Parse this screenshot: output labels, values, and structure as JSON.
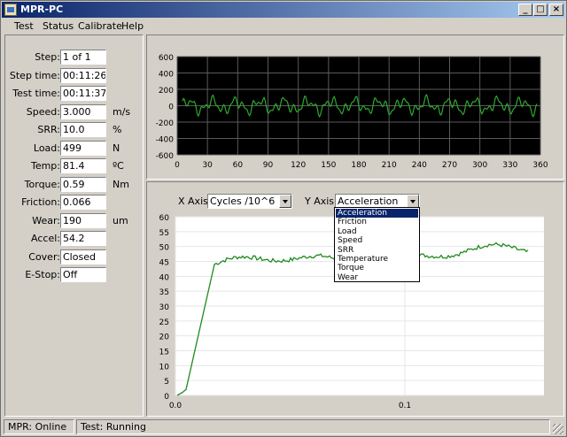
{
  "window": {
    "title": "MPR-PC",
    "min": "_",
    "max": "□",
    "close": "×"
  },
  "menu": [
    "Test",
    "Status",
    "Calibrate",
    "Help"
  ],
  "fields": [
    {
      "label": "Step:",
      "value": "1 of 1",
      "unit": ""
    },
    {
      "label": "Step time:",
      "value": "00:11:26",
      "unit": ""
    },
    {
      "label": "Test time:",
      "value": "00:11:37",
      "unit": ""
    },
    {
      "label": "Speed:",
      "value": "3.000",
      "unit": "m/s"
    },
    {
      "label": "SRR:",
      "value": "10.0",
      "unit": "%"
    },
    {
      "label": "Load:",
      "value": "499",
      "unit": "N"
    },
    {
      "label": "Temp:",
      "value": "81.4",
      "unit": "ºC"
    },
    {
      "label": "Torque:",
      "value": "0.59",
      "unit": "Nm"
    },
    {
      "label": "Friction:",
      "value": "0.066",
      "unit": ""
    },
    {
      "label": "Wear:",
      "value": "190",
      "unit": "um"
    },
    {
      "label": "Accel:",
      "value": "54.2",
      "unit": ""
    },
    {
      "label": "Cover:",
      "value": "Closed",
      "unit": ""
    },
    {
      "label": "E-Stop:",
      "value": "Off",
      "unit": ""
    }
  ],
  "top_chart": {
    "y_ticks": [
      "600",
      "400",
      "200",
      "0",
      "-200",
      "-400",
      "-600"
    ],
    "x_ticks": [
      "0",
      "30",
      "60",
      "90",
      "120",
      "150",
      "180",
      "210",
      "240",
      "270",
      "300",
      "330",
      "360"
    ],
    "background": "#000000",
    "line_color": "#2ea82e"
  },
  "controls": {
    "x_axis_label": "X Axis:",
    "x_axis_value": "Cycles /10^6",
    "y_axis_label": "Y Axis:",
    "y_axis_value": "Acceleration",
    "y_options": [
      "Acceleration",
      "Friction",
      "Load",
      "Speed",
      "SRR",
      "Temperature",
      "Torque",
      "Wear"
    ]
  },
  "bottom_chart": {
    "y_ticks": [
      "60",
      "55",
      "50",
      "45",
      "40",
      "35",
      "30",
      "25",
      "20",
      "15",
      "10",
      "5",
      "0"
    ],
    "x_ticks": [
      "0.0",
      "0.1"
    ],
    "line_color": "#1f8a1f"
  },
  "status": {
    "connection": "MPR: Online",
    "test": "Test: Running"
  }
}
